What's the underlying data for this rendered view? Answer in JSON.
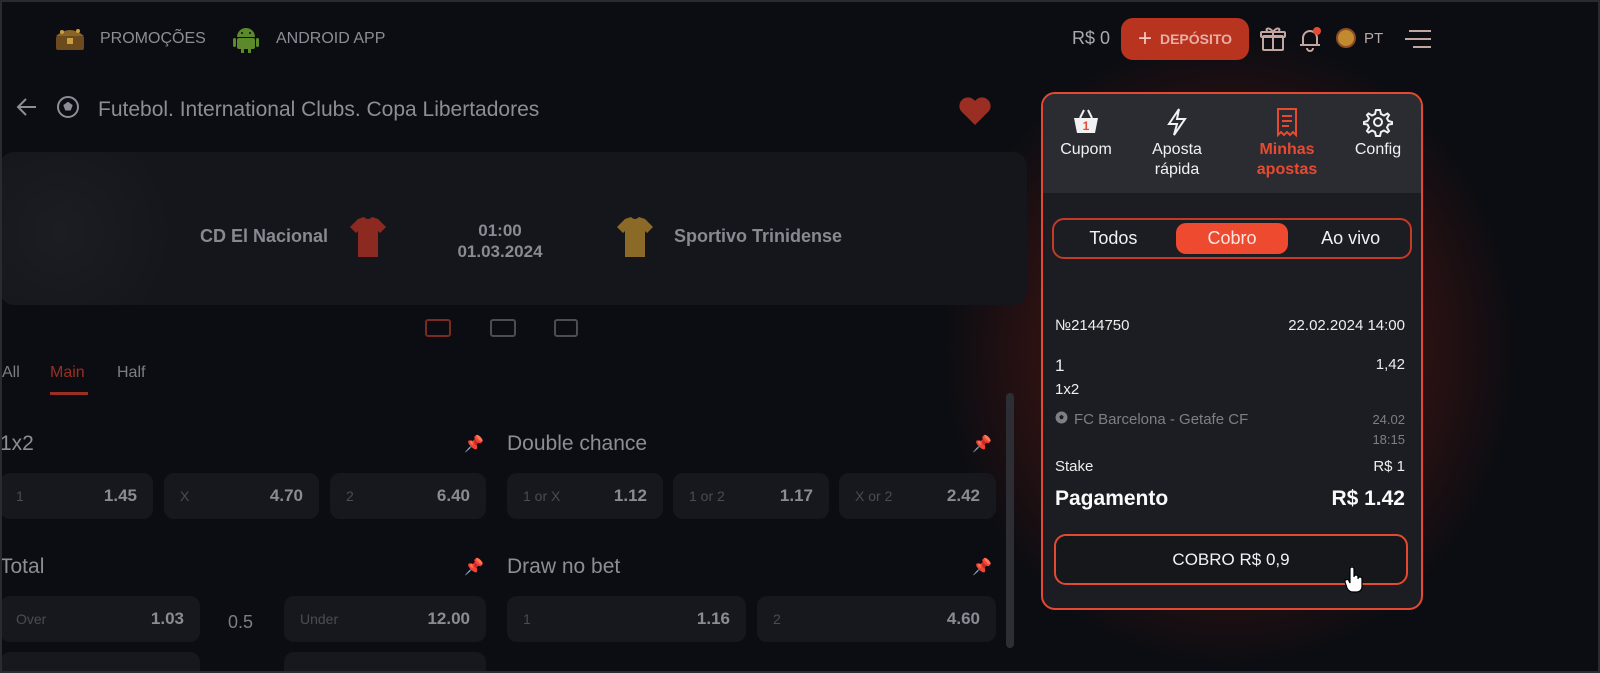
{
  "topbar": {
    "promotions_label": "PROMOÇÕES",
    "android_label": "ANDROID APP",
    "balance": "R$ 0",
    "deposit_label": "DEPÓSITO",
    "language": "PT"
  },
  "breadcrumb": {
    "title": "Futebol. International Clubs. Copa Libertadores"
  },
  "match": {
    "home_team": "CD El Nacional",
    "away_team": "Sportivo Trinidense",
    "time": "01:00",
    "date": "01.03.2024",
    "home_shirt_color": "#8c2a22",
    "away_shirt_color": "#8a6a26"
  },
  "market_tabs": [
    "All",
    "Main",
    "Half"
  ],
  "markets": {
    "m1x2": {
      "title": "1x2",
      "odds": [
        {
          "label": "1",
          "value": "1.45"
        },
        {
          "label": "X",
          "value": "4.70"
        },
        {
          "label": "2",
          "value": "6.40"
        }
      ]
    },
    "double_chance": {
      "title": "Double chance",
      "odds": [
        {
          "label": "1 or X",
          "value": "1.12"
        },
        {
          "label": "1 or 2",
          "value": "1.17"
        },
        {
          "label": "X or 2",
          "value": "2.42"
        }
      ]
    },
    "total": {
      "title": "Total",
      "line": "0.5",
      "odds": [
        {
          "label": "Over",
          "value": "1.03"
        },
        {
          "label": "Under",
          "value": "12.00"
        }
      ]
    },
    "draw_no_bet": {
      "title": "Draw no bet",
      "odds": [
        {
          "label": "1",
          "value": "1.16"
        },
        {
          "label": "2",
          "value": "4.60"
        }
      ]
    }
  },
  "betslip": {
    "tabs": [
      {
        "label": "Cupom",
        "badge": "1"
      },
      {
        "label": "Aposta rápida"
      },
      {
        "label": "Minhas apostas"
      },
      {
        "label": "Config"
      }
    ],
    "filters": [
      "Todos",
      "Cobro",
      "Ao vivo"
    ],
    "bet": {
      "number": "№2144750",
      "placed_at": "22.02.2024 14:00",
      "selection": "1",
      "odds": "1,42",
      "market": "1x2",
      "event": "FC Barcelona - Getafe CF",
      "event_date": "24.02",
      "event_time": "18:15",
      "stake_label": "Stake",
      "stake_value": "R$ 1",
      "payout_label": "Pagamento",
      "payout_value": "R$ 1.42",
      "cashout_label": "COBRO R$ 0,9"
    }
  },
  "colors": {
    "accent": "#e34a31",
    "background": "#0c0d12"
  }
}
